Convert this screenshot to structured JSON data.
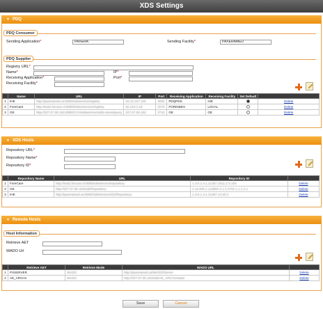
{
  "title": "XDS Settings",
  "pdq": {
    "header": "PDQ",
    "consumer": {
      "title": "PDQ Consumer",
      "sending_application_label": "Sending Application",
      "sending_application_value": "PAXERA",
      "sending_facility_label": "Sending Facility",
      "sending_facility_value": "PAXERAMED"
    },
    "supplier": {
      "title": "PDQ Supplier",
      "registry_url_label": "Registry URL",
      "name_label": "Name",
      "ip_label": "IP",
      "receiving_application_label": "Receiving Application",
      "port_label": "Port",
      "receiving_facility_label": "Receiving Facility",
      "columns": [
        "Name",
        "URL",
        "IP",
        "Port",
        "Receiving Application",
        "Receiving Facility",
        "Set Default",
        ""
      ],
      "rows": [
        {
          "num": "1",
          "name": "IHE",
          "url": "http://paxeramed.us:8080/xdsservice/registry",
          "ip": "54.23.247.100",
          "port": "3600",
          "app": "PDQPDS",
          "facility": "IHE",
          "default": true,
          "action": "Delete"
        },
        {
          "num": "2",
          "name": "ForeCare",
          "url": "http://test2.forcare.nl:8080/index/service/registry",
          "ip": "92.243.3.18",
          "port": "2576",
          "app": "FORINDEX",
          "facility": "LOCAL",
          "default": false,
          "action": "Delete"
        },
        {
          "num": "3",
          "name": "GE",
          "url": "http://207.67.80.162:8080/CCH/xdsservice/xdsb-storedquery",
          "ip": "207.67.80.162",
          "port": "3710",
          "app": "GE",
          "facility": "GE",
          "default": false,
          "action": "Delete"
        }
      ]
    }
  },
  "xds_hosts": {
    "header": "XDS Hosts",
    "repository_url_label": "Repository URL",
    "repository_name_label": "Repository Name",
    "repository_id_label": "Repository ID",
    "columns": [
      "Repository Name",
      "URL",
      "Repository ID",
      ""
    ],
    "rows": [
      {
        "num": "1",
        "name": "ForeCare",
        "url": "http://test2.forcare.nl:8080/xds/service/repository",
        "id": "1.3.6.1.4.1.21367.2011.2.3.100",
        "action": "Delete"
      },
      {
        "num": "2",
        "name": "GE",
        "url": "http://207.67.80.164/xds/Repository",
        "id": "2.16.840.1.113883.3.1.3.2702.1.1.1.2.1",
        "action": "Delete"
      },
      {
        "num": "3",
        "name": "IHE",
        "url": "http://paxeramed.us:8080/XdsService/XDSRepository",
        "id": "1.3.6.1.4.1.21367.13.40.2",
        "action": "Delete"
      }
    ]
  },
  "remote_hosts": {
    "header": "Remote Hosts",
    "host_info_title": "Host Information",
    "retrieve_aet_label": "Retrieve AET",
    "wado_url_label": "WADO Url",
    "columns": [
      "Retrieve AET",
      "Retrieve Mode",
      "WADO URL",
      ""
    ],
    "rows": [
      {
        "num": "1",
        "aet": "PXSERVER",
        "mode": "WADO",
        "url": "http://paxeramed.us/WADO/Server",
        "action": "Delete"
      },
      {
        "num": "2",
        "aet": "AE_ARCH1",
        "mode": "WADO",
        "url": "http://207.67.80.164/xds/AE_ARCH1/wado",
        "action": "Delete"
      }
    ]
  },
  "footer": {
    "save_label": "Save",
    "cancel_label": "Cancel"
  },
  "colors": {
    "accent": "#ec8f10",
    "title_bar": "#4a4a4a",
    "table_header": "#3b3b3b",
    "link": "#1a3fb8"
  }
}
